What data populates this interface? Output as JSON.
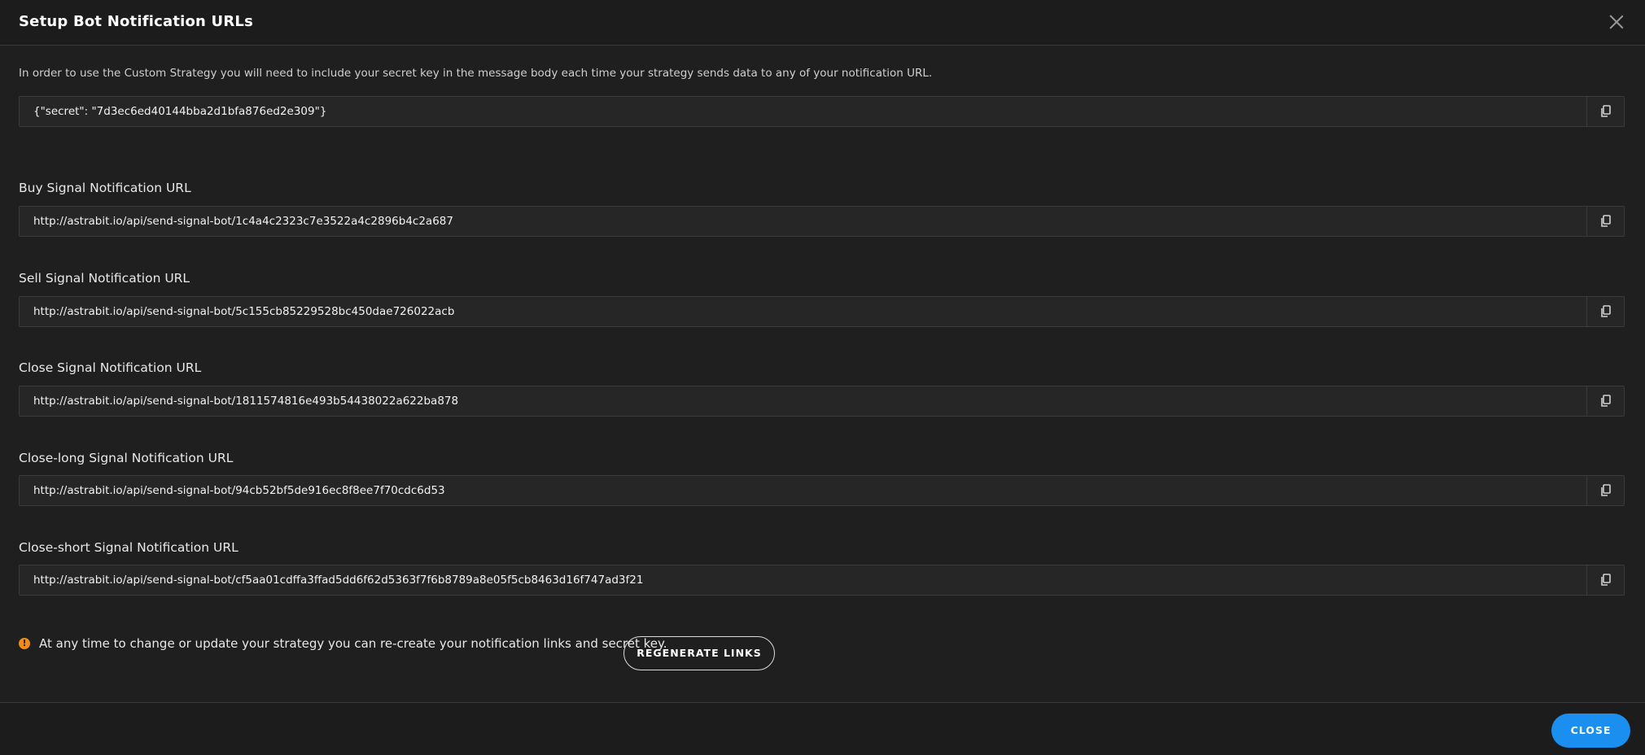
{
  "modal": {
    "title": "Setup Bot Notification URLs",
    "intro": "In order to use the Custom Strategy you will need to include your secret key in the message body each time your strategy sends data to any of your notification URL.",
    "secret_value": "{\"secret\": \"7d3ec6ed40144bba2d1bfa876ed2e309\"}"
  },
  "fields": [
    {
      "label": "Buy Signal Notification URL",
      "value": "http://astrabit.io/api/send-signal-bot/1c4a4c2323c7e3522a4c2896b4c2a687"
    },
    {
      "label": "Sell Signal Notification URL",
      "value": "http://astrabit.io/api/send-signal-bot/5c155cb85229528bc450dae726022acb"
    },
    {
      "label": "Close Signal Notification URL",
      "value": "http://astrabit.io/api/send-signal-bot/1811574816e493b54438022a622ba878"
    },
    {
      "label": "Close-long Signal Notification URL",
      "value": "http://astrabit.io/api/send-signal-bot/94cb52bf5de916ec8f8ee7f70cdc6d53"
    },
    {
      "label": "Close-short Signal Notification URL",
      "value": "http://astrabit.io/api/send-signal-bot/cf5aa01cdffa3ffad5dd6f62d5363f7f6b8789a8e05f5cb8463d16f747ad3f21"
    }
  ],
  "note": {
    "icon": "warning-icon",
    "text": "At any time to change or update your strategy you can re-create your notification links and secret key.",
    "regenerate_label": "REGENERATE LINKS"
  },
  "footer": {
    "close_label": "CLOSE"
  },
  "colors": {
    "background": "#1f1f1f",
    "accent": "#1a8ff0",
    "warning": "#f28c18"
  }
}
